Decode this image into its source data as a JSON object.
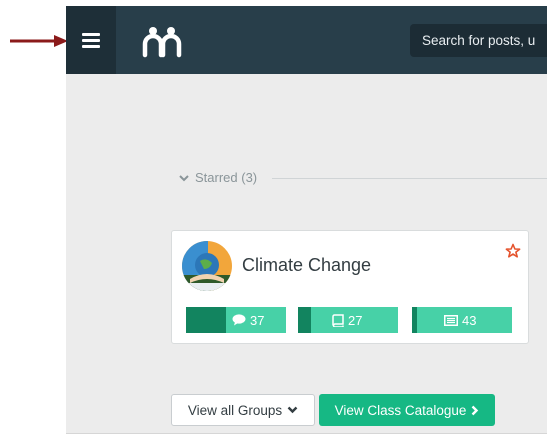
{
  "header": {
    "menu_icon": "hamburger-icon",
    "logo_icon": "people-logo-icon",
    "search_placeholder": "Search for posts, u"
  },
  "starred": {
    "label": "Starred (3)",
    "icon": "chevron-down-icon"
  },
  "card": {
    "title": "Climate Change",
    "star_icon": "star-outline-icon",
    "stats": [
      {
        "icon": "comment-icon",
        "value": "37",
        "progress": 0.4
      },
      {
        "icon": "book-icon",
        "value": "27",
        "progress": 0.13
      },
      {
        "icon": "newspaper-icon",
        "value": "43",
        "progress": 0.05
      }
    ]
  },
  "buttons": {
    "view_groups": "View all Groups",
    "view_catalogue": "View Class Catalogue"
  },
  "colors": {
    "topbar": "#283e4a",
    "menu_bg": "#1e2f38",
    "accent_green": "#16b884",
    "stat_light": "#47d1a7",
    "stat_dark": "#12845f",
    "arrow": "#8b1a1a",
    "star": "#e5532d"
  }
}
